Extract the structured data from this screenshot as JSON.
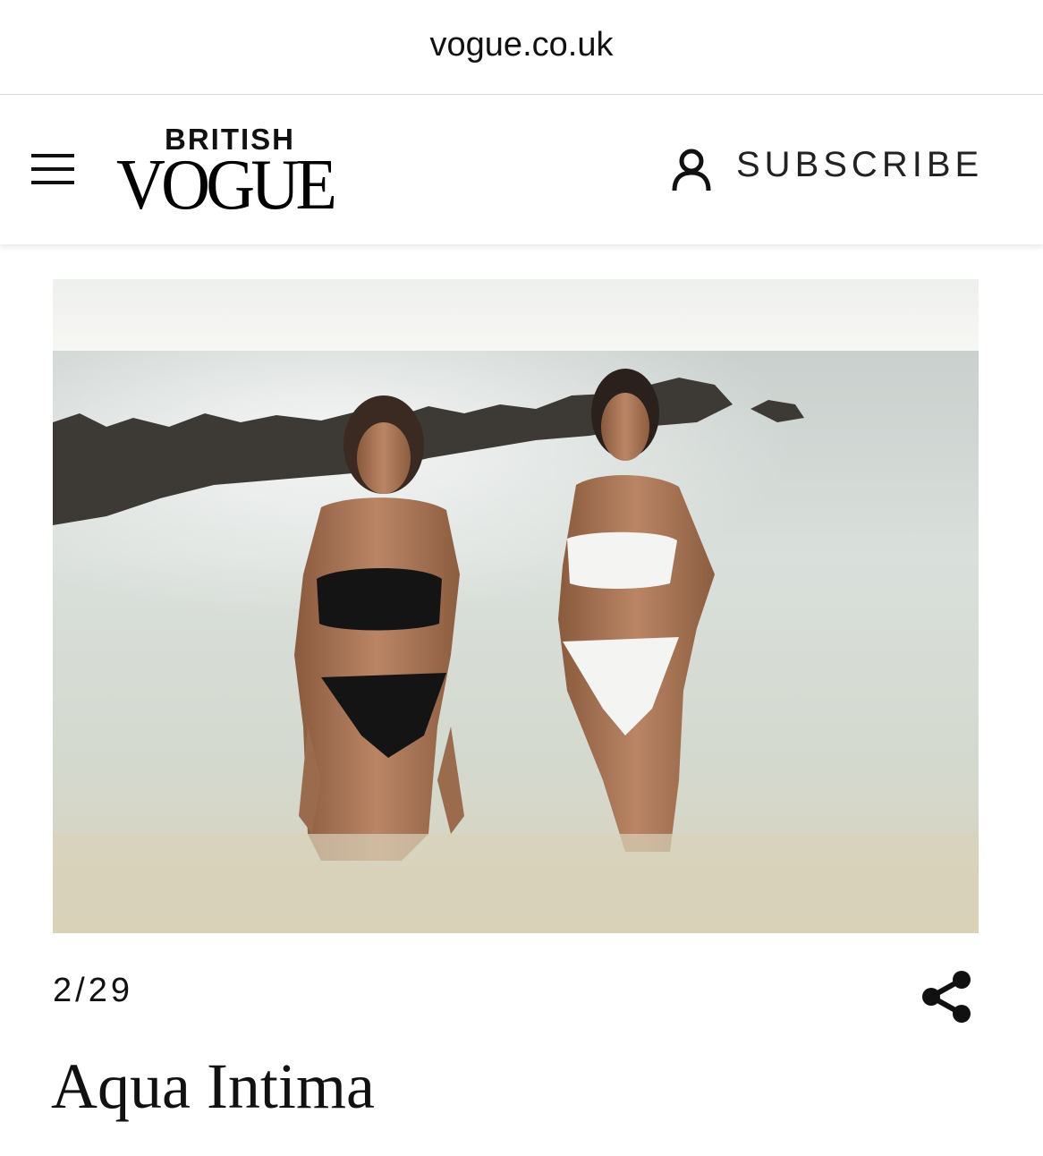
{
  "browser": {
    "url": "vogue.co.uk"
  },
  "header": {
    "menu_icon": "hamburger-menu-icon",
    "logo_top": "BRITISH",
    "logo_main": "VOGUE",
    "account_icon": "user-icon",
    "subscribe_label": "SUBSCRIBE"
  },
  "gallery": {
    "counter": "2/29",
    "share_icon": "share-icon",
    "caption_title": "Aqua Intima"
  },
  "colors": {
    "background": "#ffffff",
    "text": "#111111",
    "divider": "#d8d8d8"
  }
}
